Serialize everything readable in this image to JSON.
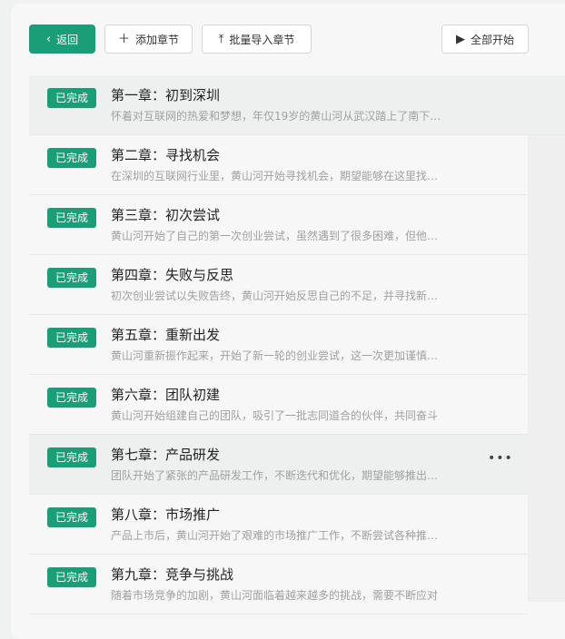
{
  "toolbar": {
    "back_label": "返回",
    "add_label": "添加章节",
    "import_label": "批量导入章节",
    "start_label": "全部开始"
  },
  "chapters": [
    {
      "status": "已完成",
      "title": "第一章：初到深圳",
      "desc": "怀着对互联网的热爱和梦想，年仅19岁的黄山河从武汉踏上了南下深圳的旅程"
    },
    {
      "status": "已完成",
      "title": "第二章：寻找机会",
      "desc": "在深圳的互联网行业里，黄山河开始寻找机会，期望能够在这里找到自己的位置"
    },
    {
      "status": "已完成",
      "title": "第三章：初次尝试",
      "desc": "黄山河开始了自己的第一次创业尝试，虽然遇到了很多困难，但他没有放弃"
    },
    {
      "status": "已完成",
      "title": "第四章：失败与反思",
      "desc": "初次创业尝试以失败告终，黄山河开始反思自己的不足，并寻找新的方向"
    },
    {
      "status": "已完成",
      "title": "第五章：重新出发",
      "desc": "黄山河重新振作起来，开始了新一轮的创业尝试，这一次更加谨慎和坚定"
    },
    {
      "status": "已完成",
      "title": "第六章：团队初建",
      "desc": "黄山河开始组建自己的团队，吸引了一批志同道合的伙伴，共同奋斗"
    },
    {
      "status": "已完成",
      "title": "第七章：产品研发",
      "desc": "团队开始了紧张的产品研发工作，不断迭代和优化，期望能够推出好产品"
    },
    {
      "status": "已完成",
      "title": "第八章：市场推广",
      "desc": "产品上市后，黄山河开始了艰难的市场推广工作，不断尝试各种推广方式"
    },
    {
      "status": "已完成",
      "title": "第九章：竞争与挑战",
      "desc": "随着市场竞争的加剧，黄山河面临着越来越多的挑战，需要不断应对"
    }
  ],
  "icons": {
    "back": "chevron-left-icon",
    "add": "plus-icon",
    "import": "upload-icon",
    "start": "play-icon",
    "more": "more-horizontal-icon"
  }
}
